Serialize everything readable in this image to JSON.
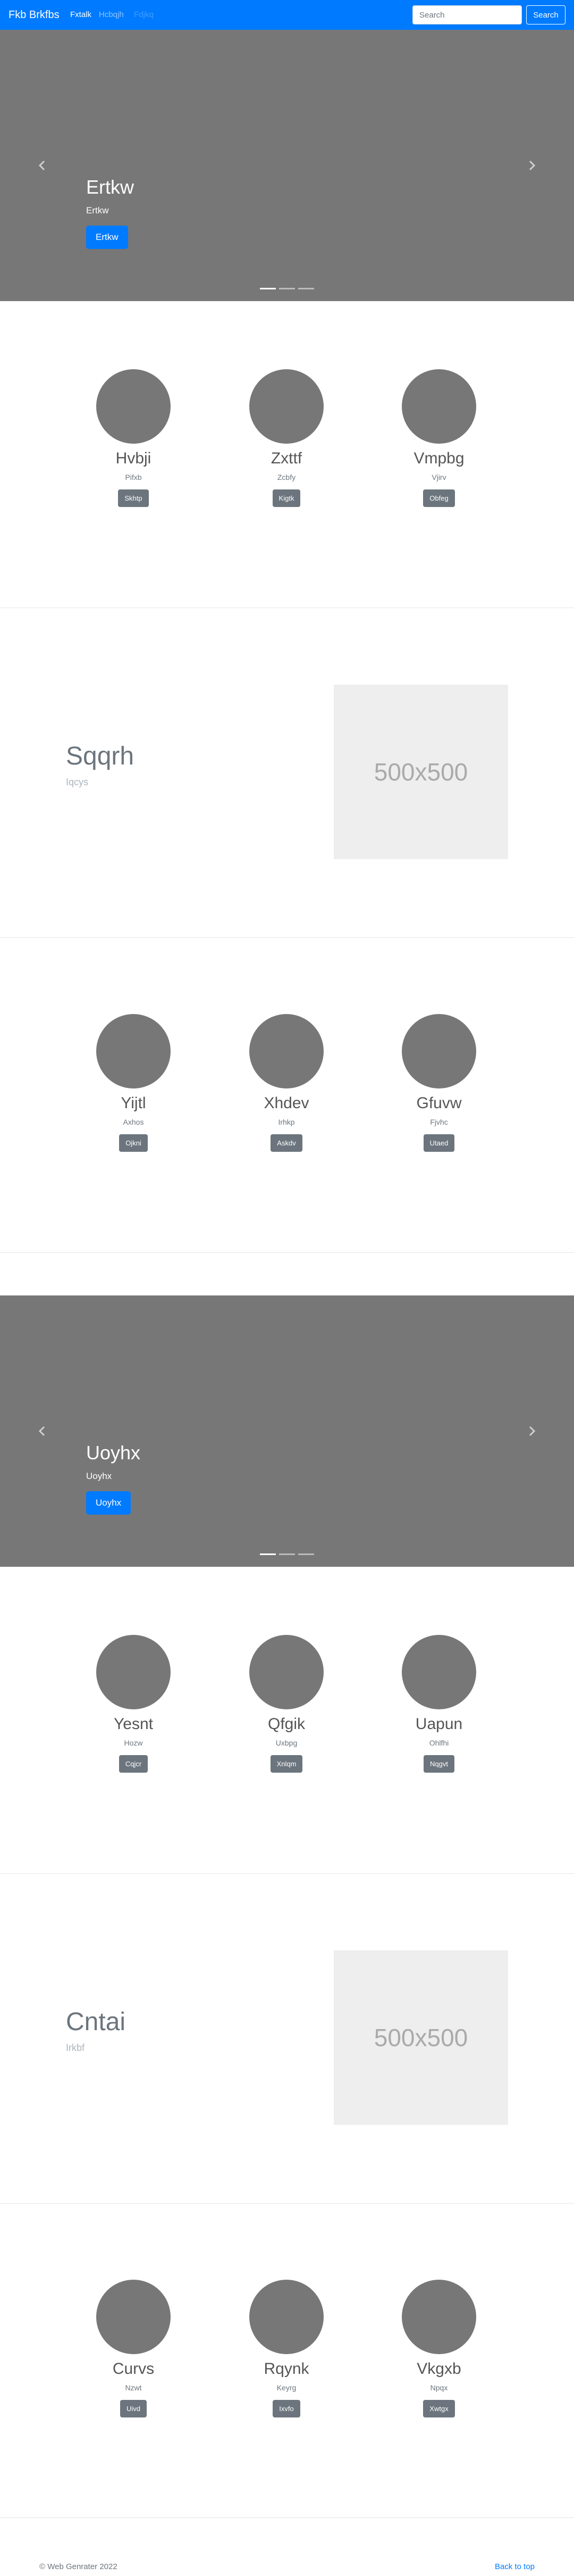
{
  "navbar": {
    "brand": "Fkb Brkfbs",
    "links": [
      "Fxtalk",
      "Hcbqjh",
      "Fdjkq"
    ],
    "search_placeholder": "Search",
    "search_button": "Search"
  },
  "carousel1": {
    "title": "Ertkw",
    "subtitle": "Ertkw",
    "button": "Ertkw"
  },
  "features1": [
    {
      "title": "Hvbji",
      "sub": "Pifxb",
      "button": "Skhtp"
    },
    {
      "title": "Zxttf",
      "sub": "Zcbfy",
      "button": "Kigtk"
    },
    {
      "title": "Vmpbg",
      "sub": "Vjirv",
      "button": "Obfeg"
    }
  ],
  "featurette1": {
    "title": "Sqqrh",
    "subtitle": "Iqcys",
    "placeholder": "500x500"
  },
  "features2": [
    {
      "title": "Yijtl",
      "sub": "Axhos",
      "button": "Ojkni"
    },
    {
      "title": "Xhdev",
      "sub": "Irhkp",
      "button": "Askdv"
    },
    {
      "title": "Gfuvw",
      "sub": "Fjvhc",
      "button": "Utaed"
    }
  ],
  "carousel2": {
    "title": "Uoyhx",
    "subtitle": "Uoyhx",
    "button": "Uoyhx"
  },
  "features3": [
    {
      "title": "Yesnt",
      "sub": "Hozw",
      "button": "Cqjcr"
    },
    {
      "title": "Qfgik",
      "sub": "Uxbpg",
      "button": "Xnlqm"
    },
    {
      "title": "Uapun",
      "sub": "Ohlfhi",
      "button": "Nqgvt"
    }
  ],
  "featurette2": {
    "title": "Cntai",
    "subtitle": "Irkbf",
    "placeholder": "500x500"
  },
  "features4": [
    {
      "title": "Curvs",
      "sub": "Nzwt",
      "button": "Uivd"
    },
    {
      "title": "Rqynk",
      "sub": "Keyrg",
      "button": "Ixvfo"
    },
    {
      "title": "Vkgxb",
      "sub": "Npqx",
      "button": "Xwtgx"
    }
  ],
  "footer": {
    "copyright": "© Web Genrater 2022",
    "back_to_top": "Back to top"
  },
  "colors": {
    "primary": "#007bff",
    "secondary": "#6c757d",
    "carousel_bg": "#777777",
    "placeholder_bg": "#eeeeee"
  }
}
